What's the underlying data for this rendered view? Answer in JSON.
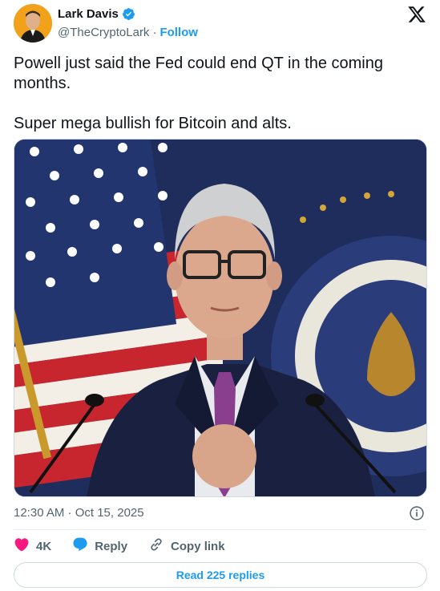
{
  "author": {
    "name": "Lark Davis",
    "handle": "@TheCryptoLark",
    "separator": "·",
    "follow_label": "Follow",
    "avatar_bg": "#f2a11a"
  },
  "tweet": {
    "paragraphs": [
      "Powell just said the Fed could end QT in the coming months.",
      "Super mega bullish for Bitcoin and alts."
    ],
    "timestamp": "12:30 AM · Oct 15, 2025",
    "media_icon": "photo"
  },
  "actions": {
    "like_count": "4K",
    "reply_label": "Reply",
    "copy_link_label": "Copy link"
  },
  "read_replies_label": "Read 225 replies",
  "colors": {
    "accent": "#1d9bf0",
    "like": "#f91880",
    "muted": "#536471",
    "text": "#0f1419"
  },
  "icons": {
    "verified": "verified-badge-icon",
    "x_logo": "x-logo-icon",
    "info": "info-icon",
    "like": "heart-icon",
    "reply": "speech-bubble-icon",
    "copy_link": "link-icon"
  }
}
